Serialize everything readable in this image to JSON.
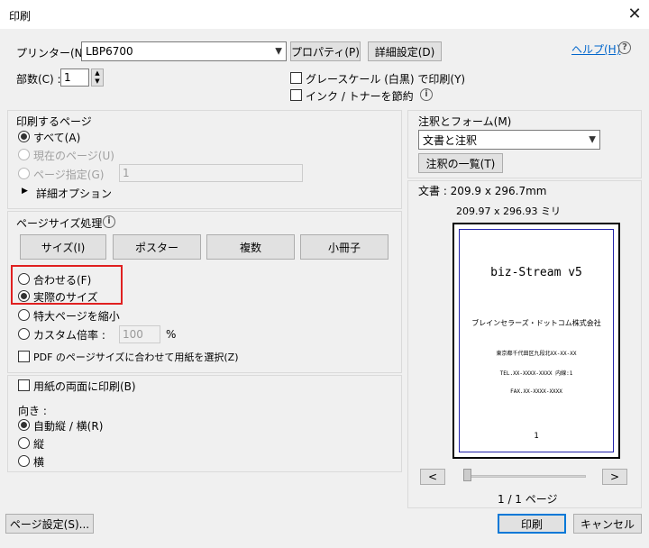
{
  "window": {
    "title": "印刷",
    "close_glyph": "✕"
  },
  "printer": {
    "label": "プリンター(N) :",
    "selected": "LBP6700",
    "properties_button": "プロパティ(P)",
    "advanced_button": "詳細設定(D)",
    "help_link": "ヘルプ(H)",
    "copies_label": "部数(C) :",
    "copies_value": "1",
    "grayscale_label": "グレースケール (白黒) で印刷(Y)",
    "save_ink_label": "インク / トナーを節約"
  },
  "pages": {
    "heading": "印刷するページ",
    "all": "すべて(A)",
    "current": "現在のページ(U)",
    "range": "ページ指定(G)",
    "range_value": "1",
    "more_options": "詳細オプション"
  },
  "sizing": {
    "heading": "ページサイズ処理",
    "tabs": [
      "サイズ(I)",
      "ポスター",
      "複数",
      "小冊子"
    ],
    "fit": "合わせる(F)",
    "actual": "実際のサイズ",
    "shrink": "特大ページを縮小",
    "custom": "カスタム倍率 :",
    "custom_value": "100",
    "percent": "%",
    "choose_paper": "PDF のページサイズに合わせて用紙を選択(Z)"
  },
  "duplex": {
    "label": "用紙の両面に印刷(B)"
  },
  "orientation": {
    "heading": "向き :",
    "auto": "自動縦 / 横(R)",
    "portrait": "縦",
    "landscape": "横"
  },
  "comments": {
    "heading": "注釈とフォーム(M)",
    "selected": "文書と注釈",
    "summarize_button": "注釈の一覧(T)"
  },
  "preview": {
    "doc_size": "文書 : 209.9 x 296.7mm",
    "paper_size": "209.97 x 296.93 ミリ",
    "page_lines": [
      "biz-Stream v5",
      "ブレインセラーズ・ドットコム株式会社",
      "東京都千代田区九段北XX-XX-XX",
      "TEL.XX-XXXX-XXXX 内線:1",
      "FAX.XX-XXXX-XXXX"
    ],
    "page_number": "1",
    "prev_button": "<",
    "next_button": ">",
    "page_indicator": "1 / 1 ページ"
  },
  "footer": {
    "page_setup": "ページ設定(S)...",
    "print": "印刷",
    "cancel": "キャンセル"
  },
  "colors": {
    "highlight": "#e02020",
    "link": "#0066cc",
    "accent": "#0078d7"
  }
}
